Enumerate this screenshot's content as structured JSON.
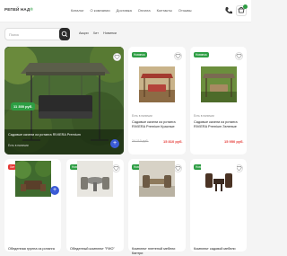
{
  "header": {
    "logo_text": "РЕПЕЙ НАД",
    "logo_suffix": "®",
    "nav": [
      "Каталог",
      "О компании",
      "Доставка",
      "Оплата",
      "Контакты",
      "Отзывы"
    ],
    "icons": [
      "phone-icon",
      "cart-icon"
    ]
  },
  "search": {
    "placeholder": "Поиск"
  },
  "filters": [
    "Акции",
    "Хит",
    "Новинки"
  ],
  "hero": {
    "price": "11 300 руб.",
    "title": "Садовые качели из ротанга RIVIERA Premium",
    "availability": "Есть в наличии"
  },
  "cards": [
    {
      "badge": "Новинка",
      "title": "Садовые качели из ротанга RIVIERA Premium Красные",
      "availability": "Есть в наличии",
      "old_price": "24 110 руб.",
      "price": "15 810 руб."
    },
    {
      "badge": "Новинка",
      "title": "Садовые качели из ротанга RIVIERA Premium Зеленые",
      "availability": "Есть в наличии",
      "old_price": "",
      "price": "15 950 руб."
    },
    {
      "badge": "Хит",
      "title": "Обеденная группа из ротанга",
      "availability": "",
      "old_price": "",
      "price": ""
    },
    {
      "badge": "Новинка",
      "title": "Обеденный комплект \"РИО\"",
      "availability": "",
      "old_price": "",
      "price": ""
    },
    {
      "badge": "Новинка",
      "title": "Комплект плетеной мебели Кантри",
      "availability": "",
      "old_price": "",
      "price": ""
    },
    {
      "badge": "Новинка",
      "title": "Комплект садовой мебели",
      "availability": "",
      "old_price": "",
      "price": ""
    }
  ]
}
